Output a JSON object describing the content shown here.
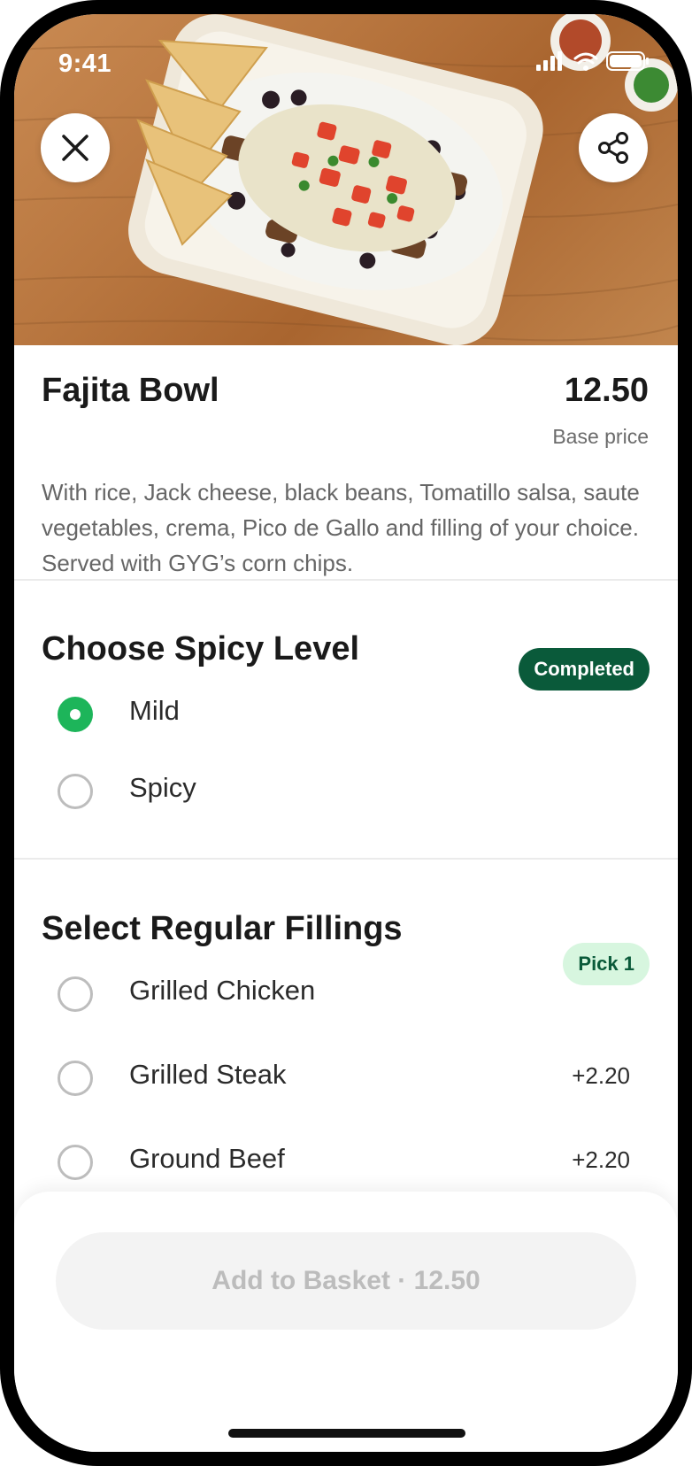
{
  "status_bar": {
    "time": "9:41"
  },
  "hero": {
    "image": "fajita-bowl-photo"
  },
  "header_buttons": {
    "close_icon": "close-icon",
    "share_icon": "share-icon"
  },
  "product": {
    "title": "Fajita Bowl",
    "price": "12.50",
    "price_caption": "Base price",
    "description": "With rice, Jack cheese, black beans, Tomatillo salsa, saute vegetables, crema, Pico de Gallo and filling of your choice. Served with GYG’s corn chips."
  },
  "spicy_section": {
    "title": "Choose Spicy Level",
    "badge": "Completed",
    "options": [
      {
        "label": "Mild",
        "selected": true
      },
      {
        "label": "Spicy",
        "selected": false
      }
    ]
  },
  "fillings_section": {
    "title": "Select Regular Fillings",
    "badge": "Pick 1",
    "options": [
      {
        "label": "Grilled Chicken",
        "price": "",
        "selected": false
      },
      {
        "label": "Grilled Steak",
        "price": "+2.20",
        "selected": false
      },
      {
        "label": "Ground Beef",
        "price": "+2.20",
        "selected": false
      }
    ]
  },
  "footer": {
    "add_to_basket_label": "Add to Basket · 12.50"
  },
  "colors": {
    "primary_green": "#1db55a",
    "dark_green": "#0a5a3a",
    "light_green": "#d7f6df",
    "disabled_button": "#f3f3f3"
  }
}
